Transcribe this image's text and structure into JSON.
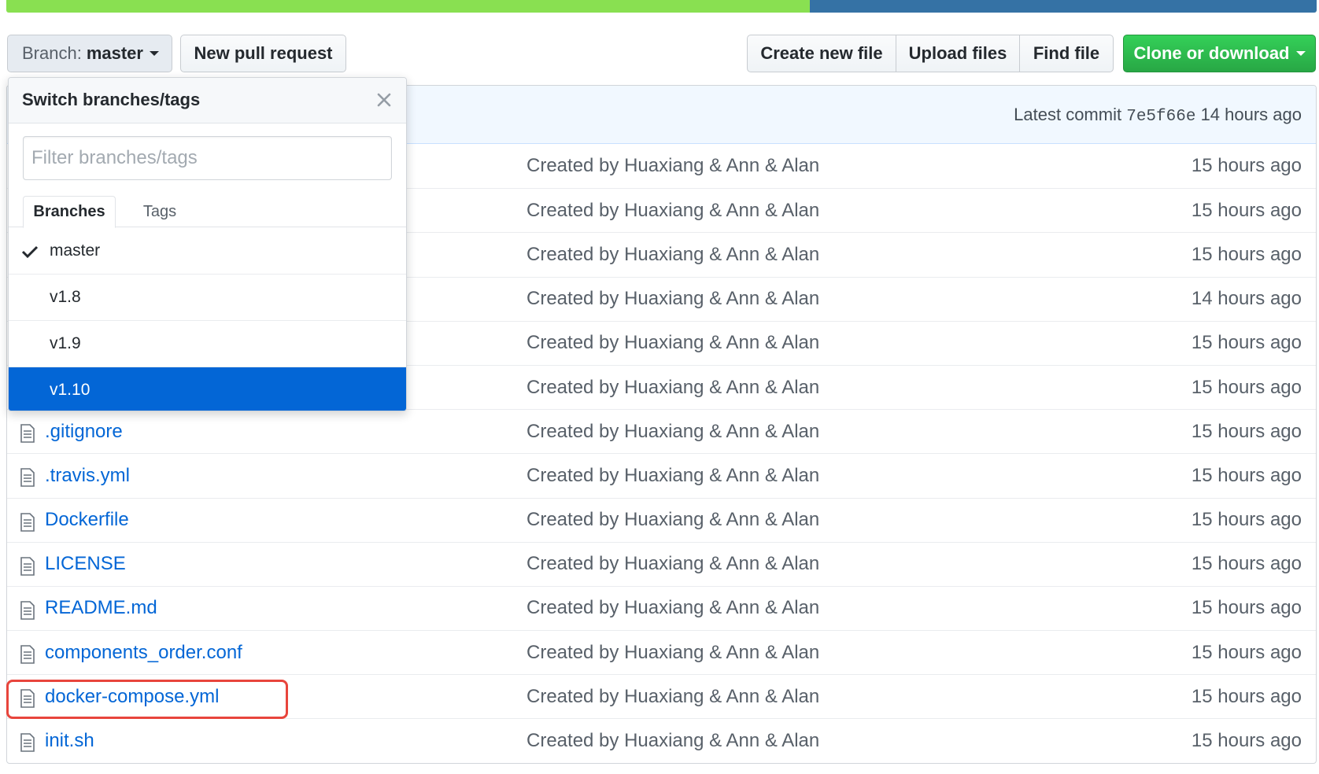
{
  "language_bar": [
    {
      "color": "#89e051",
      "percent": 61.3
    },
    {
      "color": "#3572A5",
      "percent": 38.7
    }
  ],
  "toolbar": {
    "branch_label": "Branch:",
    "branch_value": "master",
    "new_pull_request": "New pull request",
    "create_new_file": "Create new file",
    "upload_files": "Upload files",
    "find_file": "Find file",
    "clone_or_download": "Clone or download"
  },
  "commit": {
    "latest_label": "Latest commit",
    "sha": "7e5f66e",
    "age": "14 hours ago"
  },
  "dropdown": {
    "title": "Switch branches/tags",
    "filter_placeholder": "Filter branches/tags",
    "tabs": [
      "Branches",
      "Tags"
    ],
    "items": [
      {
        "name": "master",
        "checked": true,
        "selected": false
      },
      {
        "name": "v1.8",
        "checked": false,
        "selected": false
      },
      {
        "name": "v1.9",
        "checked": false,
        "selected": false
      },
      {
        "name": "v1.10",
        "checked": false,
        "selected": true
      }
    ]
  },
  "files": [
    {
      "name": "",
      "message": "Created by Huaxiang & Ann & Alan",
      "age": "15 hours ago"
    },
    {
      "name": "",
      "message": "Created by Huaxiang & Ann & Alan",
      "age": "15 hours ago"
    },
    {
      "name": "",
      "message": "Created by Huaxiang & Ann & Alan",
      "age": "15 hours ago"
    },
    {
      "name": "",
      "message": "Created by Huaxiang & Ann & Alan",
      "age": "14 hours ago"
    },
    {
      "name": "",
      "message": "Created by Huaxiang & Ann & Alan",
      "age": "15 hours ago"
    },
    {
      "name": "",
      "message": "Created by Huaxiang & Ann & Alan",
      "age": "15 hours ago"
    },
    {
      "name": ".gitignore",
      "message": "Created by Huaxiang & Ann & Alan",
      "age": "15 hours ago"
    },
    {
      "name": ".travis.yml",
      "message": "Created by Huaxiang & Ann & Alan",
      "age": "15 hours ago"
    },
    {
      "name": "Dockerfile",
      "message": "Created by Huaxiang & Ann & Alan",
      "age": "15 hours ago"
    },
    {
      "name": "LICENSE",
      "message": "Created by Huaxiang & Ann & Alan",
      "age": "15 hours ago"
    },
    {
      "name": "README.md",
      "message": "Created by Huaxiang & Ann & Alan",
      "age": "15 hours ago"
    },
    {
      "name": "components_order.conf",
      "message": "Created by Huaxiang & Ann & Alan",
      "age": "15 hours ago"
    },
    {
      "name": "docker-compose.yml",
      "message": "Created by Huaxiang & Ann & Alan",
      "age": "15 hours ago",
      "highlighted": true
    },
    {
      "name": "init.sh",
      "message": "Created by Huaxiang & Ann & Alan",
      "age": "15 hours ago"
    }
  ]
}
